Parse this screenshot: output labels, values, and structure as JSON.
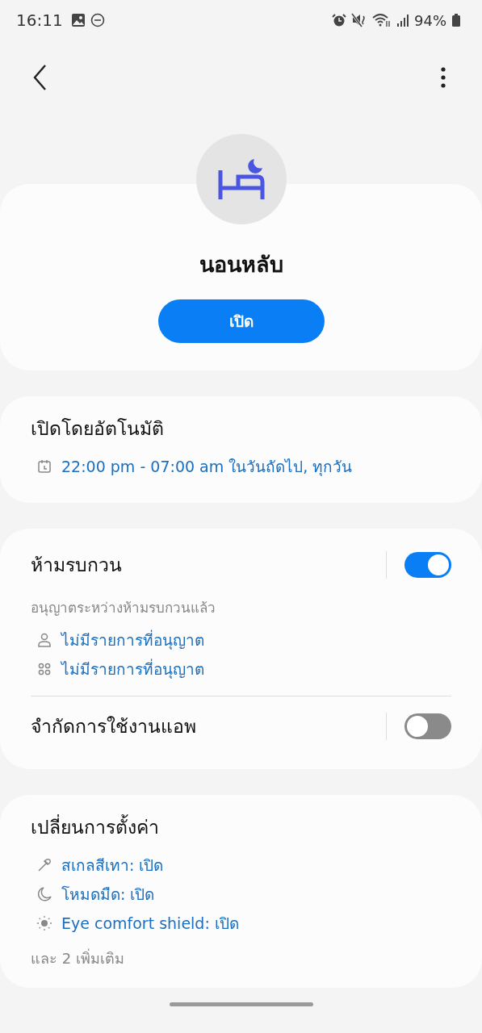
{
  "status_bar": {
    "time": "16:11",
    "battery": "94%"
  },
  "profile": {
    "title": "นอนหลับ",
    "button": "เปิด"
  },
  "auto_schedule": {
    "title": "เปิดโดยอัตโนมัติ",
    "schedule": "22:00 pm - 07:00 am ในวันถัดไป, ทุกวัน"
  },
  "do_not_disturb": {
    "title": "ห้ามรบกวน",
    "on": true,
    "subtitle": "อนุญาตระหว่างห้ามรบกวนแล้ว",
    "allowed": [
      {
        "kind": "people",
        "text": "ไม่มีรายการที่อนุญาต"
      },
      {
        "kind": "apps",
        "text": "ไม่มีรายการที่อนุญาต"
      }
    ]
  },
  "app_limit": {
    "title": "จำกัดการใช้งานแอพ",
    "on": false
  },
  "settings_changes": {
    "title": "เปลี่ยนการตั้งค่า",
    "items": [
      {
        "kind": "grayscale",
        "text": "สเกลสีเทา: เปิด"
      },
      {
        "kind": "dark_mode",
        "text": "โหมดมืด: เปิด"
      },
      {
        "kind": "eye_comfort",
        "text": "Eye comfort shield: เปิด"
      }
    ],
    "more": "และ 2 เพิ่มเติม"
  }
}
